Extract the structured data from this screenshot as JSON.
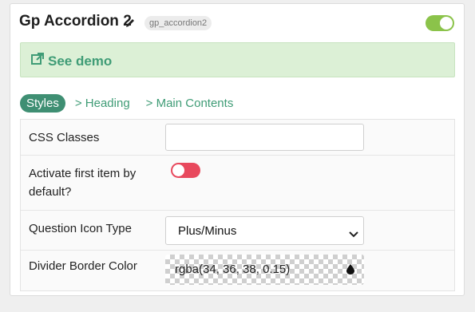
{
  "header": {
    "title": "Gp Accordion 2",
    "slug": "gp_accordion2",
    "enabled": true
  },
  "demo": {
    "label": "See demo"
  },
  "tabs": [
    {
      "label": "Styles",
      "active": true
    },
    {
      "label": "> Heading",
      "active": false
    },
    {
      "label": "> Main Contents",
      "active": false
    }
  ],
  "fields": {
    "css_classes": {
      "label": "CSS Classes",
      "value": ""
    },
    "activate_first": {
      "label": "Activate first item by default?",
      "enabled": false
    },
    "question_icon": {
      "label": "Question Icon Type",
      "value": "Plus/Minus"
    },
    "divider_color": {
      "label": "Divider Border Color",
      "value": "rgba(34, 36, 38, 0.15)"
    }
  },
  "colors": {
    "accent": "#3f9c76",
    "toggle_on": "#8bc34a",
    "toggle_off": "#e8495d",
    "demo_bg": "#dcf0d6"
  },
  "icons": {
    "edit": "pencil-icon",
    "external": "external-link-icon",
    "select": "chevron-down-icon",
    "picker": "drop-icon"
  }
}
